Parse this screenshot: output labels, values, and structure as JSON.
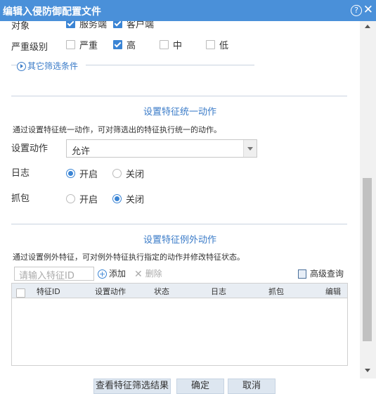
{
  "dialog": {
    "title": "编辑入侵防御配置文件",
    "help_symbol": "?",
    "close_symbol": "✕"
  },
  "filters": {
    "object_label": "对象",
    "object_options": [
      {
        "label": "服务端",
        "checked": true
      },
      {
        "label": "客户端",
        "checked": true
      }
    ],
    "severity_label": "严重级别",
    "severity_options": [
      {
        "label": "严重",
        "checked": false
      },
      {
        "label": "高",
        "checked": true
      },
      {
        "label": "中",
        "checked": false
      },
      {
        "label": "低",
        "checked": false
      }
    ],
    "other_filters_link": "其它筛选条件"
  },
  "unified_action": {
    "section_title": "设置特征统一动作",
    "description": "通过设置特征统一动作，可对筛选出的特征执行统一的动作。",
    "action_label": "设置动作",
    "action_value": "允许",
    "log_label": "日志",
    "log_options": [
      {
        "label": "开启",
        "selected": true
      },
      {
        "label": "关闭",
        "selected": false
      }
    ],
    "capture_label": "抓包",
    "capture_options": [
      {
        "label": "开启",
        "selected": false
      },
      {
        "label": "关闭",
        "selected": true
      }
    ]
  },
  "exception": {
    "section_title": "设置特征例外动作",
    "description": "通过设置例外特征，可对例外特征执行指定的动作并修改特征状态。",
    "search_placeholder": "请输入特征ID",
    "add_label": "添加",
    "delete_label": "删除",
    "advanced_query_label": "高级查询",
    "columns": [
      "特征ID",
      "设置动作",
      "状态",
      "日志",
      "抓包",
      "编辑"
    ]
  },
  "footer": {
    "view_results": "查看特征筛选结果",
    "ok": "确定",
    "cancel": "取消"
  },
  "colors": {
    "titlebar": "#4a90d9",
    "accent": "#3a84d4",
    "section_title": "#3a7bc8"
  }
}
